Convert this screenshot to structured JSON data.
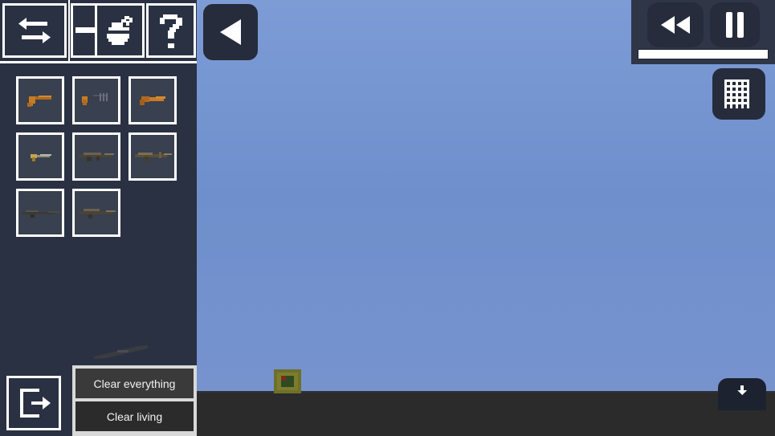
{
  "app": {
    "title": "Sandbox Weapon Spawner",
    "sky_color": "#6e8fcc",
    "ground_color": "#2b2b2b",
    "panel_color": "#2a3142"
  },
  "toolbar": {
    "items": [
      {
        "name": "swap-icon",
        "label": "Swap"
      },
      {
        "name": "next-icon",
        "label": "Next"
      },
      {
        "name": "grenade-icon",
        "label": "Grenade"
      },
      {
        "name": "help-icon",
        "label": "Help"
      }
    ]
  },
  "inventory": {
    "slots": [
      {
        "item": "pistol",
        "row": 1,
        "col": 1
      },
      {
        "item": "machine-pistol",
        "row": 1,
        "col": 2
      },
      {
        "item": "sawed-off",
        "row": 1,
        "col": 3
      },
      {
        "item": "smg",
        "row": 2,
        "col": 1
      },
      {
        "item": "assault-rifle",
        "row": 2,
        "col": 2
      },
      {
        "item": "battle-rifle",
        "row": 2,
        "col": 3
      },
      {
        "item": "sniper-rifle",
        "row": 3,
        "col": 1
      },
      {
        "item": "heavy-rifle",
        "row": 3,
        "col": 2
      }
    ]
  },
  "actions": {
    "exit_label": "Exit",
    "clear_everything": "Clear everything",
    "clear_living": "Clear living"
  },
  "playback": {
    "back_label": "Back",
    "rewind_label": "Rewind",
    "pause_label": "Pause",
    "progress_percent": 100,
    "grid_label": "Grid",
    "collapse_label": "Collapse"
  },
  "world": {
    "entity": "crate"
  }
}
